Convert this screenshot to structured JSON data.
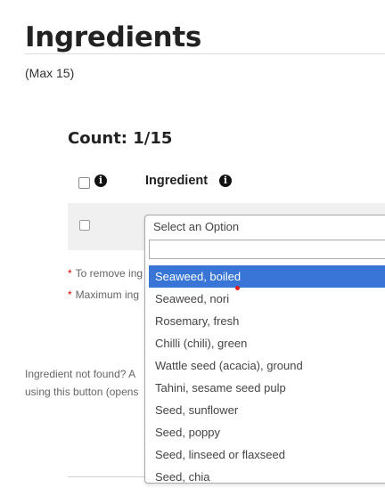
{
  "page": {
    "title": "Ingredients",
    "max_note": "(Max 15)",
    "count": "Count: 1/15"
  },
  "table": {
    "header_label": "Ingredient",
    "info_icon": "i"
  },
  "notes": {
    "remove": "To remove ing",
    "maximum": "Maximum ing",
    "star": "*"
  },
  "not_found": {
    "line1": "Ingredient not found? A",
    "line2": "using this button (opens"
  },
  "dropdown": {
    "selected_label": "Select an Option",
    "search_value": "",
    "options": [
      "Seaweed, boiled",
      "Seaweed, nori",
      "Rosemary, fresh",
      "Chilli (chili), green",
      "Wattle seed (acacia), ground",
      "Tahini, sesame seed pulp",
      "Seed, sunflower",
      "Seed, poppy",
      "Seed, linseed or flaxseed",
      "Seed, chia"
    ],
    "highlighted_index": 0
  },
  "colors": {
    "highlight": "#3875d7",
    "required_star": "#dd0000"
  }
}
